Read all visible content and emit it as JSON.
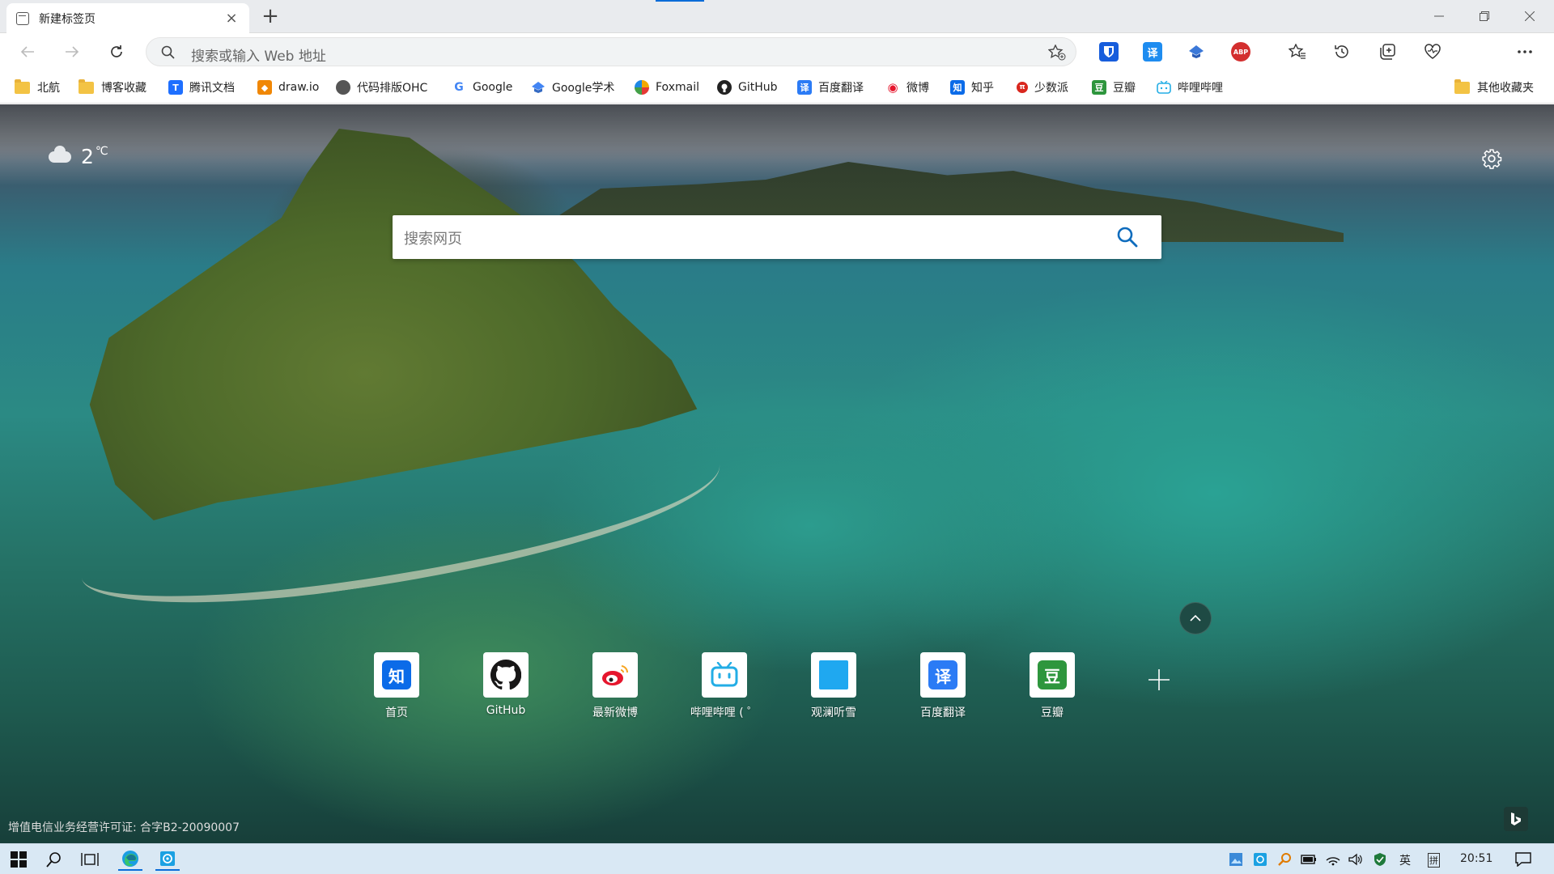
{
  "tab": {
    "title": "新建标签页",
    "close": "×",
    "new": "+"
  },
  "window": {
    "minimize": "—",
    "restore": "❐",
    "close": "✕"
  },
  "address": {
    "placeholder": "搜索或输入 Web 地址"
  },
  "extensions": [
    {
      "name": "bitwarden",
      "glyph": "U",
      "color": "#175ddc"
    },
    {
      "name": "translate",
      "glyph": "译",
      "color": "#1e8cf0"
    },
    {
      "name": "scholar-ext",
      "glyph": "◆",
      "color": "#3b78d8"
    },
    {
      "name": "adblock",
      "glyph": "ABP",
      "color": "#d32f2f"
    }
  ],
  "bookmarks": [
    {
      "label": "北航",
      "type": "folder"
    },
    {
      "label": "博客收藏",
      "type": "folder"
    },
    {
      "label": "腾讯文档",
      "icon": "tencent-docs-icon",
      "color": "#1e6fff",
      "glyph": "T"
    },
    {
      "label": "draw.io",
      "icon": "drawio-icon",
      "color": "#f08705",
      "glyph": "◆"
    },
    {
      "label": "代码排版OHC",
      "icon": "ohc-icon",
      "color": "#555",
      "glyph": "●"
    },
    {
      "label": "Google",
      "icon": "google-icon",
      "color": "#ffffff",
      "glyph": "G"
    },
    {
      "label": "Google学术",
      "icon": "scholar-icon",
      "color": "#4285f4",
      "glyph": "▲"
    },
    {
      "label": "Foxmail",
      "icon": "foxmail-icon",
      "color": "#f2a900",
      "glyph": "●"
    },
    {
      "label": "GitHub",
      "icon": "github-icon",
      "color": "#222",
      "glyph": "●"
    },
    {
      "label": "百度翻译",
      "icon": "baidu-translate-icon",
      "color": "#2b7bf5",
      "glyph": "译"
    },
    {
      "label": "微博",
      "icon": "weibo-icon",
      "color": "#e6162d",
      "glyph": "◉"
    },
    {
      "label": "知乎",
      "icon": "zhihu-icon",
      "color": "#0b6be8",
      "glyph": "知"
    },
    {
      "label": "少数派",
      "icon": "sspai-icon",
      "color": "#d9271e",
      "glyph": "π"
    },
    {
      "label": "豆瓣",
      "icon": "douban-icon",
      "color": "#2e963d",
      "glyph": "豆"
    },
    {
      "label": "哔哩哔哩",
      "icon": "bilibili-icon",
      "color": "#23ade5",
      "glyph": "▣"
    }
  ],
  "other_bookmarks": "其他收藏夹",
  "weather": {
    "temp": "2",
    "unit": "℃"
  },
  "search": {
    "placeholder": "搜索网页"
  },
  "tiles": [
    {
      "label": "首页",
      "icon": "zhihu-icon",
      "color": "#0b6be8",
      "glyph": "知"
    },
    {
      "label": "GitHub",
      "icon": "github-icon",
      "color": "#181717",
      "glyph": "●"
    },
    {
      "label": "最新微博",
      "icon": "weibo-icon",
      "color": "#e6162d",
      "glyph": "◉"
    },
    {
      "label": "哔哩哔哩 ( ゜",
      "icon": "bilibili-icon",
      "color": "#23ade5",
      "glyph": "▣"
    },
    {
      "label": "观澜听雪",
      "icon": "blue-square-icon",
      "color": "#1fa8f0",
      "glyph": ""
    },
    {
      "label": "百度翻译",
      "icon": "baidu-translate-icon",
      "color": "#2b7bf5",
      "glyph": "译"
    },
    {
      "label": "豆瓣",
      "icon": "douban-icon",
      "color": "#2e963d",
      "glyph": "豆"
    }
  ],
  "license": "增值电信业务经营许可证: 合字B2-20090007",
  "taskbar": {
    "lang": "英",
    "ime": "拼",
    "time": "20:51"
  }
}
